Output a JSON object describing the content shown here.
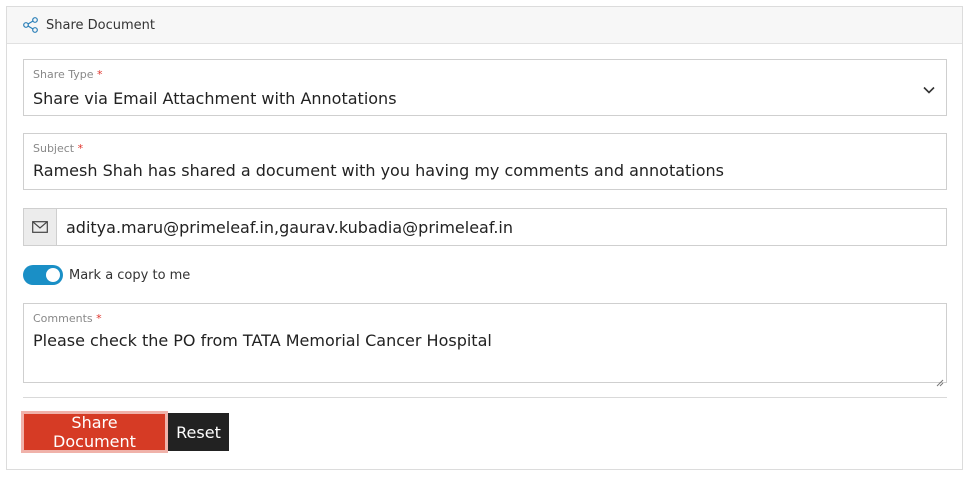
{
  "header": {
    "title": "Share Document",
    "icon": "share-icon"
  },
  "form": {
    "share_type": {
      "label": "Share Type",
      "required_mark": "*",
      "value": "Share via Email Attachment with Annotations",
      "icon": "chevron-down-icon"
    },
    "subject": {
      "label": "Subject",
      "required_mark": "*",
      "value": "Ramesh Shah has shared a document with you having my comments and annotations"
    },
    "email": {
      "icon": "envelope-icon",
      "value": "aditya.maru@primeleaf.in,gaurav.kubadia@primeleaf.in"
    },
    "copy_toggle": {
      "label": "Mark a copy to me",
      "on": true
    },
    "comments": {
      "label": "Comments",
      "required_mark": "*",
      "value": "Please check the PO from TATA Memorial Cancer Hospital"
    }
  },
  "actions": {
    "share_label": "Share Document",
    "reset_label": "Reset"
  },
  "colors": {
    "primary": "#d63b25",
    "toggle": "#1a8fc6",
    "required": "#e0332b"
  }
}
